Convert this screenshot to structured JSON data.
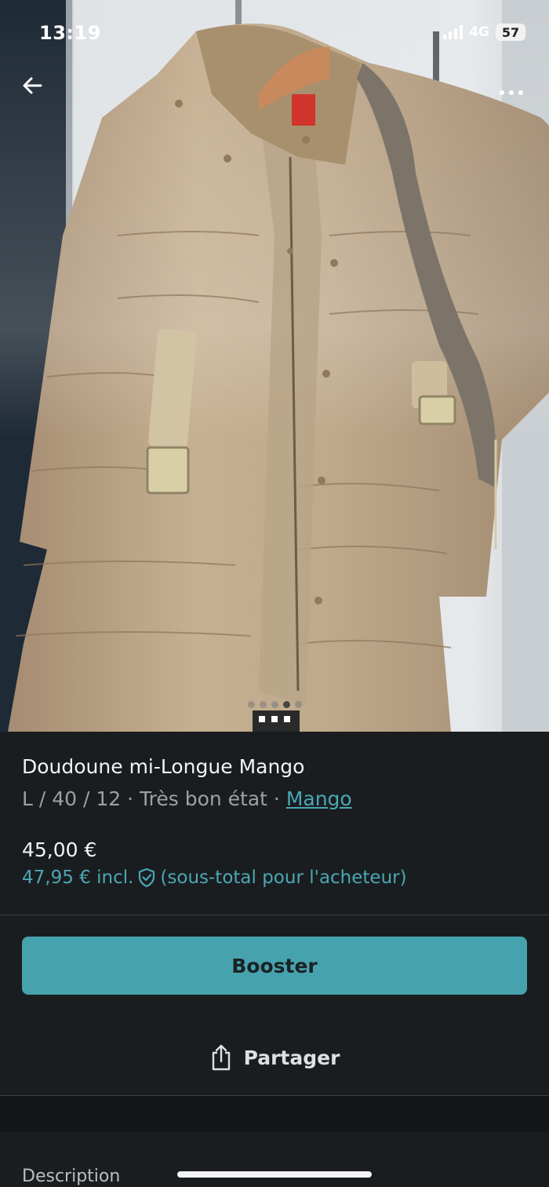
{
  "status_bar": {
    "time": "13:19",
    "network": "4G",
    "battery": "57"
  },
  "photo": {
    "icon_back": "arrow-left-icon",
    "icon_more": "more-horizontal-icon",
    "image_count": 5,
    "active_index": 4
  },
  "item": {
    "title": "Doudoune mi-Longue Mango",
    "size_condition": "L / 40 / 12 · Très bon état · ",
    "brand": "Mango",
    "price": "45,00 €",
    "price_incl": "47,95 € incl.",
    "price_incl_note": "(sous-total pour l'acheteur)"
  },
  "actions": {
    "booster_label": "Booster",
    "share_label": "Partager"
  },
  "description": {
    "label": "Description"
  },
  "colors": {
    "accent": "#46a3ae",
    "link": "#4aa8b4",
    "background": "#1a1d20"
  }
}
